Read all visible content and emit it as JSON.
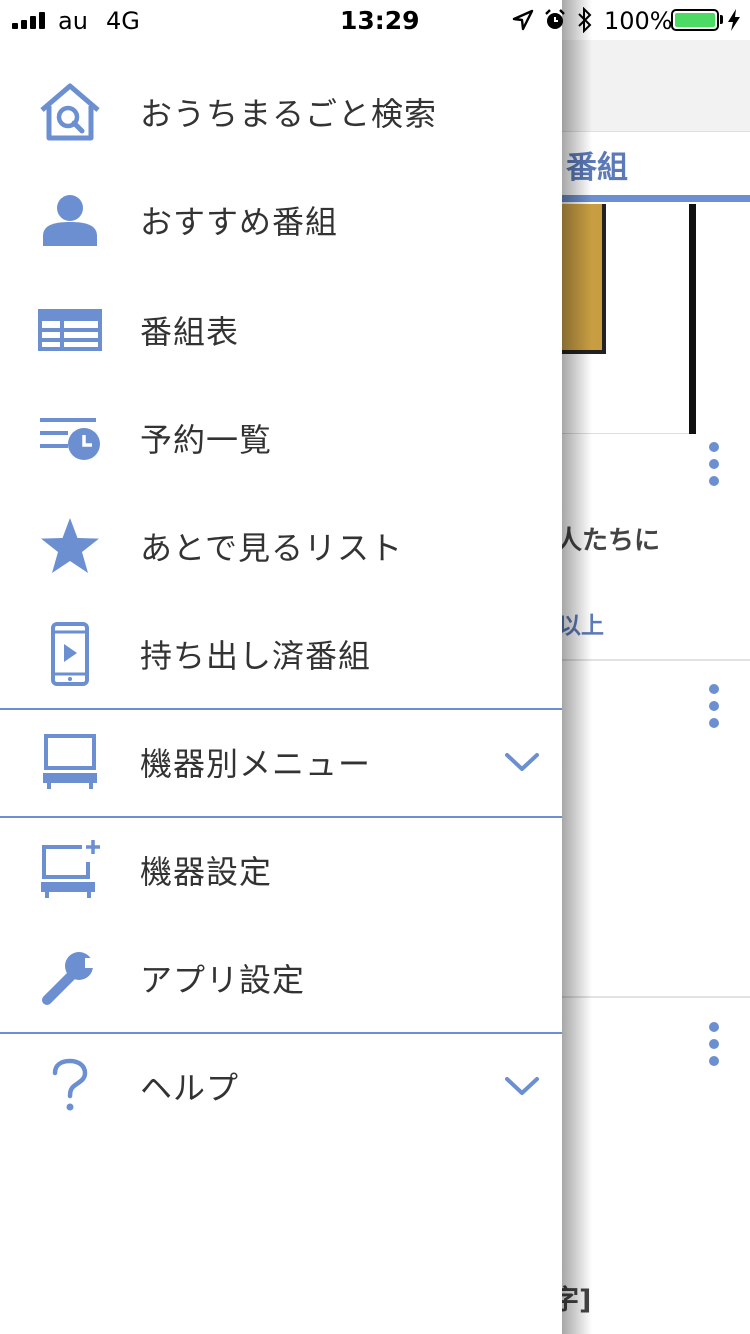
{
  "status_bar": {
    "carrier": "au",
    "network": "4G",
    "time": "13:29",
    "battery_percent": "100%",
    "battery_level": 1.0,
    "battery_color": "#4cd964"
  },
  "background": {
    "tab_label": "番組",
    "text_1": "人たちに",
    "text_2": "以上",
    "text_3": "字]"
  },
  "drawer": {
    "accent_color": "#6b8fd0",
    "items": [
      {
        "label": "おうちまるごと検索",
        "icon": "house-search-icon"
      },
      {
        "label": "おすすめ番組",
        "icon": "person-icon"
      },
      {
        "label": "番組表",
        "icon": "table-icon"
      },
      {
        "label": "予約一覧",
        "icon": "list-clock-icon"
      },
      {
        "label": "あとで見るリスト",
        "icon": "star-icon"
      },
      {
        "label": "持ち出し済番組",
        "icon": "phone-play-icon"
      },
      {
        "label": "機器別メニュー",
        "icon": "device-icon",
        "expandable": true
      },
      {
        "label": "機器設定",
        "icon": "device-add-icon"
      },
      {
        "label": "アプリ設定",
        "icon": "wrench-icon"
      },
      {
        "label": "ヘルプ",
        "icon": "question-icon",
        "expandable": true
      }
    ]
  }
}
